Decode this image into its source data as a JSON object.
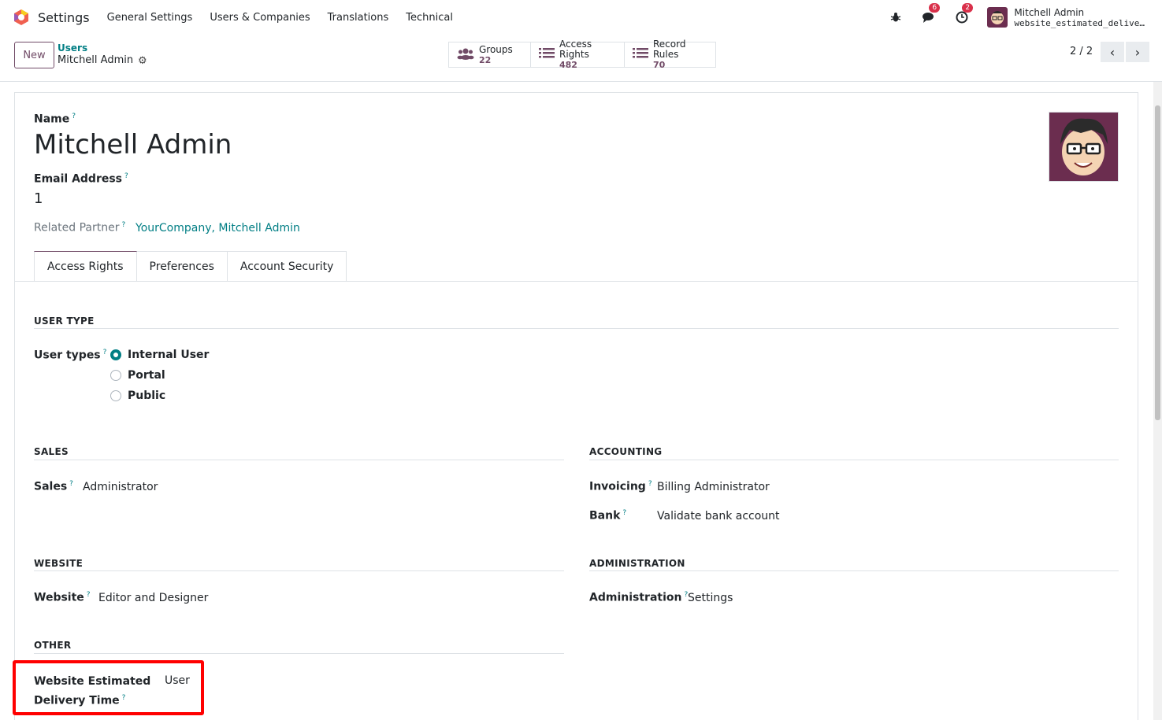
{
  "navbar": {
    "app_name": "Settings",
    "menu": [
      "General Settings",
      "Users & Companies",
      "Translations",
      "Technical"
    ],
    "messages_badge": "6",
    "activities_badge": "2",
    "user_name": "Mitchell Admin",
    "database": "website_estimated_delive…"
  },
  "control_panel": {
    "new_label": "New",
    "breadcrumb_parent": "Users",
    "breadcrumb_current": "Mitchell Admin",
    "smart_buttons": [
      {
        "label": "Groups",
        "value": "22",
        "icon": "users-icon"
      },
      {
        "label": "Access Rights",
        "value": "482",
        "icon": "list-icon"
      },
      {
        "label": "Record Rules",
        "value": "70",
        "icon": "list-icon"
      }
    ],
    "pager": "2 / 2"
  },
  "form": {
    "name_label": "Name",
    "name_value": "Mitchell Admin",
    "email_label": "Email Address",
    "email_value": "1",
    "related_partner_label": "Related Partner",
    "related_partner_value": "YourCompany, Mitchell Admin",
    "help_mark": "?",
    "tabs": [
      "Access Rights",
      "Preferences",
      "Account Security"
    ],
    "user_type_title": "USER TYPE",
    "user_types_label": "User types",
    "user_type_options": [
      "Internal User",
      "Portal",
      "Public"
    ],
    "sales_title": "SALES",
    "sales_label": "Sales",
    "sales_value": "Administrator",
    "accounting_title": "ACCOUNTING",
    "invoicing_label": "Invoicing",
    "invoicing_value": "Billing Administrator",
    "bank_label": "Bank",
    "bank_value": "Validate bank account",
    "website_title": "WEBSITE",
    "website_label": "Website",
    "website_value": "Editor and Designer",
    "administration_title": "ADMINISTRATION",
    "administration_label": "Administration",
    "administration_value": "Settings",
    "other_title": "OTHER",
    "wedt_label_line1": "Website Estimated",
    "wedt_label_line2": "Delivery Time",
    "wedt_value": "User"
  }
}
